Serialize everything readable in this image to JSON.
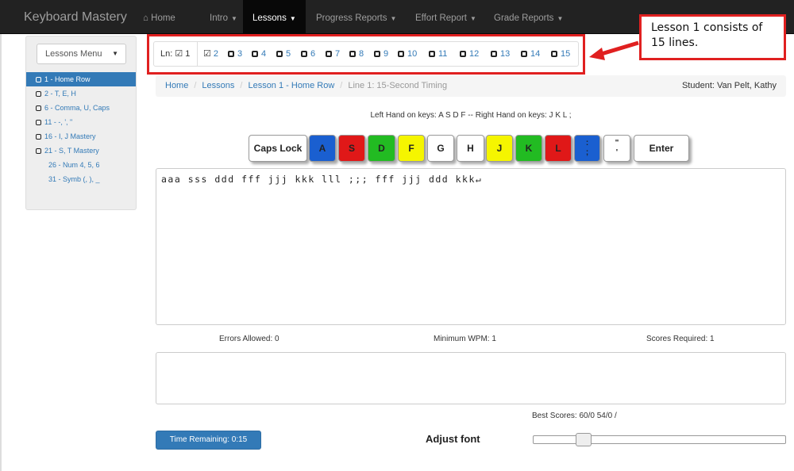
{
  "navbar": {
    "brand": "Keyboard Mastery",
    "home": "Home",
    "items": [
      "Intro",
      "Lessons",
      "Progress Reports",
      "Effort Report",
      "Grade Reports"
    ]
  },
  "sidebar": {
    "menu_label": "Lessons Menu",
    "items": [
      {
        "label": "1 - Home Row",
        "active": true,
        "checkbox": true
      },
      {
        "label": "2 - T, E, H",
        "checkbox": true
      },
      {
        "label": "6 - Comma, U, Caps",
        "checkbox": true
      },
      {
        "label": "11 - -, ', \"",
        "checkbox": true
      },
      {
        "label": "16 - I, J Mastery",
        "checkbox": true
      },
      {
        "label": "21 - S, T Mastery",
        "checkbox": true
      },
      {
        "label": "26 - Num 4, 5, 6",
        "checkbox": false
      },
      {
        "label": "31 - Symb (, ), _",
        "checkbox": false
      }
    ]
  },
  "lines": {
    "label": "Ln:",
    "current": "1",
    "items": [
      "2",
      "3",
      "4",
      "5",
      "6",
      "7",
      "8",
      "9",
      "10",
      "11",
      "12",
      "13",
      "14",
      "15"
    ]
  },
  "callout": {
    "line1": "Lesson 1 consists of",
    "line2": "15 lines."
  },
  "breadcrumb": {
    "home": "Home",
    "lessons": "Lessons",
    "lesson": "Lesson 1 - Home Row",
    "current": "Line 1: 15-Second Timing",
    "student": "Student: Van Pelt, Kathy"
  },
  "hands_text": "Left Hand on keys: A S D F -- Right Hand on keys: J K L ;",
  "keys": [
    {
      "label": "Caps Lock",
      "color": "#ffffff"
    },
    {
      "label": "A",
      "color": "#1a5fd0"
    },
    {
      "label": "S",
      "color": "#e01818"
    },
    {
      "label": "D",
      "color": "#22bb22"
    },
    {
      "label": "F",
      "color": "#f5f500"
    },
    {
      "label": "G",
      "color": "#ffffff"
    },
    {
      "label": "H",
      "color": "#ffffff"
    },
    {
      "label": "J",
      "color": "#f5f500"
    },
    {
      "label": "K",
      "color": "#22bb22"
    },
    {
      "label": "L",
      "color": "#e01818"
    },
    {
      "label": ":\n;",
      "color": "#1a5fd0"
    },
    {
      "label": "\"\n'",
      "color": "#ffffff"
    },
    {
      "label": "Enter",
      "color": "#ffffff"
    }
  ],
  "typing_text": "aaa sss ddd fff jjj kkk lll ;;; fff jjj ddd kkk↵",
  "stats": {
    "errors": "Errors Allowed: 0",
    "min_wpm": "Minimum WPM: 1",
    "scores": "Scores Required: 1"
  },
  "best_scores": "Best Scores: 60/0 54/0   /",
  "timer": "Time Remaining: 0:15",
  "adjust_font": "Adjust font",
  "font_slider_level": 0.18
}
